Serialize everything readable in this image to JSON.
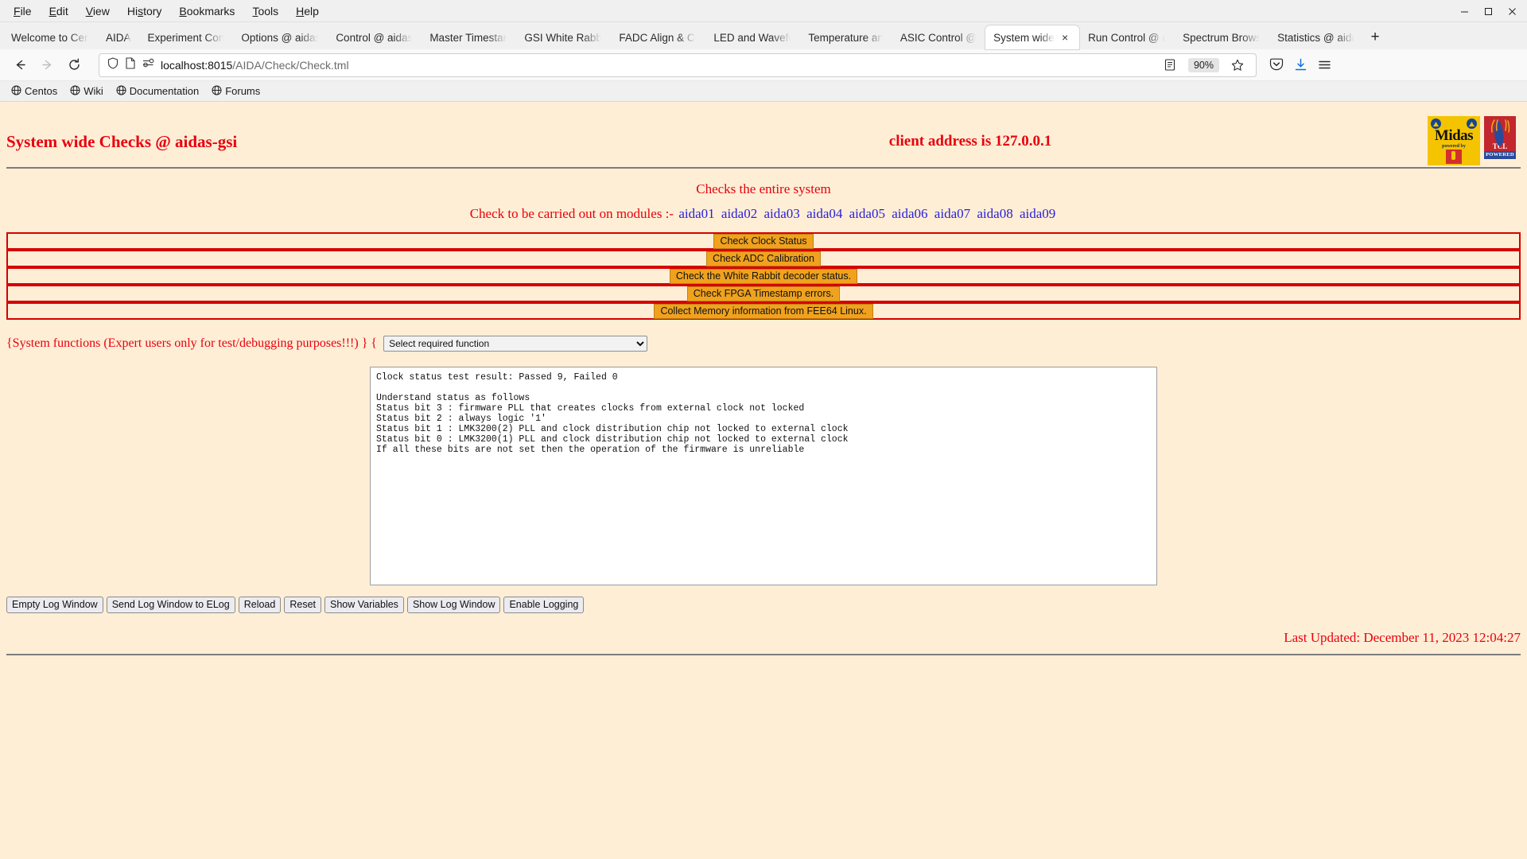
{
  "browser": {
    "menu": [
      {
        "label": "File",
        "accel": "F"
      },
      {
        "label": "Edit",
        "accel": "E"
      },
      {
        "label": "View",
        "accel": "V"
      },
      {
        "label": "History",
        "accel": "s"
      },
      {
        "label": "Bookmarks",
        "accel": "B"
      },
      {
        "label": "Tools",
        "accel": "T"
      },
      {
        "label": "Help",
        "accel": "H"
      }
    ],
    "window_controls": {
      "minimize": "minimize-icon",
      "maximize": "maximize-icon",
      "close": "close-icon"
    },
    "tabs": [
      {
        "label": "Welcome to Cen",
        "active": false
      },
      {
        "label": "AIDA",
        "active": false
      },
      {
        "label": "Experiment Con",
        "active": false
      },
      {
        "label": "Options @ aidas",
        "active": false
      },
      {
        "label": "Control @ aidas",
        "active": false
      },
      {
        "label": "Master Timestam",
        "active": false
      },
      {
        "label": "GSI White Rabbi",
        "active": false
      },
      {
        "label": "FADC Align & Co",
        "active": false
      },
      {
        "label": "LED and Wavefo",
        "active": false
      },
      {
        "label": "Temperature an",
        "active": false
      },
      {
        "label": "ASIC Control @",
        "active": false
      },
      {
        "label": "System wide C",
        "active": true
      },
      {
        "label": "Run Control @ a",
        "active": false
      },
      {
        "label": "Spectrum Brows",
        "active": false
      },
      {
        "label": "Statistics @ aida",
        "active": false
      }
    ],
    "new_tab_label": "+",
    "nav": {
      "back": "back-icon",
      "forward": "forward-icon",
      "reload": "reload-icon"
    },
    "url": {
      "host": "localhost:8015",
      "path": "/AIDA/Check/Check.tml",
      "full": "localhost:8015/AIDA/Check/Check.tml"
    },
    "zoom_level": "90%",
    "bookmarks": [
      {
        "label": "Centos"
      },
      {
        "label": "Wiki"
      },
      {
        "label": "Documentation"
      },
      {
        "label": "Forums"
      }
    ]
  },
  "page": {
    "title": "System wide Checks @ aidas-gsi",
    "client_address": "client address is 127.0.0.1",
    "logos": {
      "midas": {
        "name": "Midas",
        "powered_by": "powered by"
      },
      "tcl": {
        "name": "TCL",
        "powered": "POWERED"
      }
    },
    "subtitle": "Checks the entire system",
    "modules_label": "Check to be carried out on modules :-",
    "modules": [
      "aida01",
      "aida02",
      "aida03",
      "aida04",
      "aida05",
      "aida06",
      "aida07",
      "aida08",
      "aida09"
    ],
    "check_buttons": [
      {
        "label": "Check Clock Status"
      },
      {
        "label": "Check ADC Calibration"
      },
      {
        "label": "Check the White Rabbit decoder status."
      },
      {
        "label": "Check FPGA Timestamp errors."
      },
      {
        "label": "Collect Memory information from FEE64 Linux."
      }
    ],
    "system_functions_label": "{System functions (Expert users only for test/debugging purposes!!!)  } {",
    "system_functions_select": {
      "value": "Select required function",
      "options": [
        "Select required function"
      ]
    },
    "log_text": "Clock status test result: Passed 9, Failed 0\n\nUnderstand status as follows\nStatus bit 3 : firmware PLL that creates clocks from external clock not locked\nStatus bit 2 : always logic '1'\nStatus bit 1 : LMK3200(2) PLL and clock distribution chip not locked to external clock\nStatus bit 0 : LMK3200(1) PLL and clock distribution chip not locked to external clock\nIf all these bits are not set then the operation of the firmware is unreliable",
    "footer_buttons": [
      {
        "label": "Empty Log Window"
      },
      {
        "label": "Send Log Window to ELog"
      },
      {
        "label": "Reload"
      },
      {
        "label": "Reset"
      },
      {
        "label": "Show Variables"
      },
      {
        "label": "Show Log Window"
      },
      {
        "label": "Enable Logging"
      }
    ],
    "last_updated": "Last Updated: December 11, 2023 12:04:27",
    "colors": {
      "page_background": "#ffeed6",
      "accent_red": "#e8000d",
      "link_blue": "#2a20d8",
      "button_orange": "#f0a21e",
      "border_red": "#d60000"
    }
  }
}
